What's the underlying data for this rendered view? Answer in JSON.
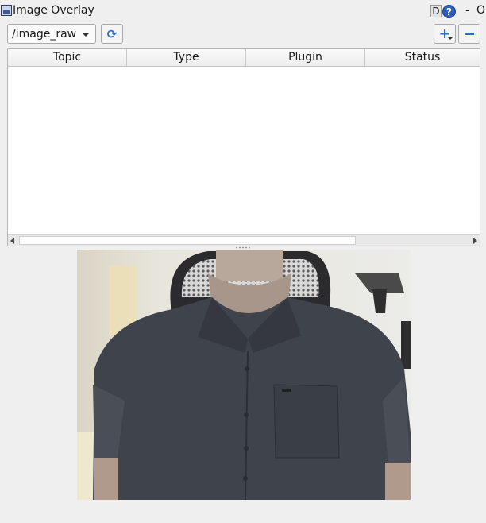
{
  "window": {
    "title": "Image Overlay",
    "d_label": "D",
    "help_label": "?",
    "dash_label": "-",
    "close_label": "O"
  },
  "toolbar": {
    "topic_value": "/image_raw",
    "refresh_icon": "refresh-icon",
    "add_icon": "plus-icon",
    "remove_icon": "minus-icon"
  },
  "table": {
    "columns": [
      "Topic",
      "Type",
      "Plugin",
      "Status"
    ],
    "rows": []
  },
  "colors": {
    "accent": "#2d6cc9",
    "background": "#efefef",
    "shirt": "#3f434c"
  }
}
